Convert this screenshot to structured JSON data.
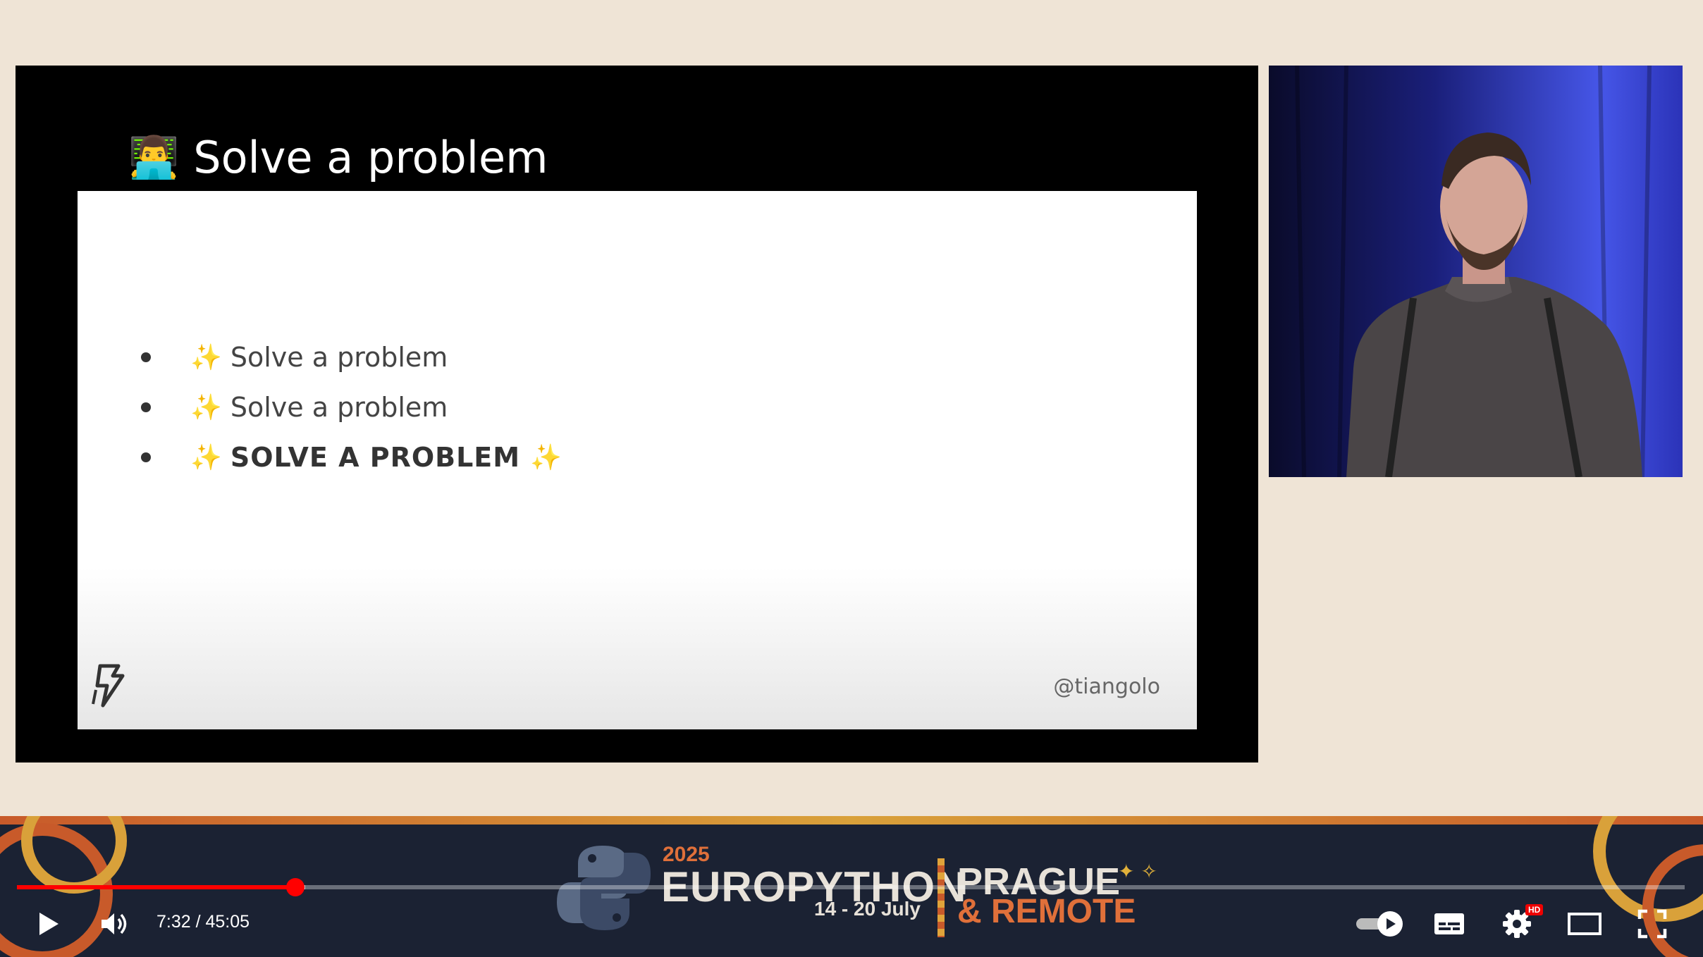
{
  "slide": {
    "title": "Solve a problem",
    "title_icon": "technologist-emoji",
    "bullets": [
      {
        "icon": "sparkles",
        "text": "Solve a problem"
      },
      {
        "icon": "sparkles",
        "text": "Solve a problem"
      },
      {
        "icon": "sparkles",
        "text": "SOLVE A PROBLEM",
        "trailing_icon": "sparkles"
      }
    ],
    "handle": "@tiangolo",
    "logo_icon": "fastapi-lightning-logo"
  },
  "banner": {
    "year": "2025",
    "name": "EUROPYTHON",
    "dates": "14 - 20 July",
    "city": "PRAGUE",
    "remote": "& REMOTE"
  },
  "player": {
    "current_time": "7:32",
    "duration": "45:05",
    "time_display": "7:32 / 45:05",
    "progress_fraction": 0.167,
    "hd_label": "HD",
    "colors": {
      "progress": "#ff0000",
      "banner_accent": "#e0703a"
    }
  }
}
